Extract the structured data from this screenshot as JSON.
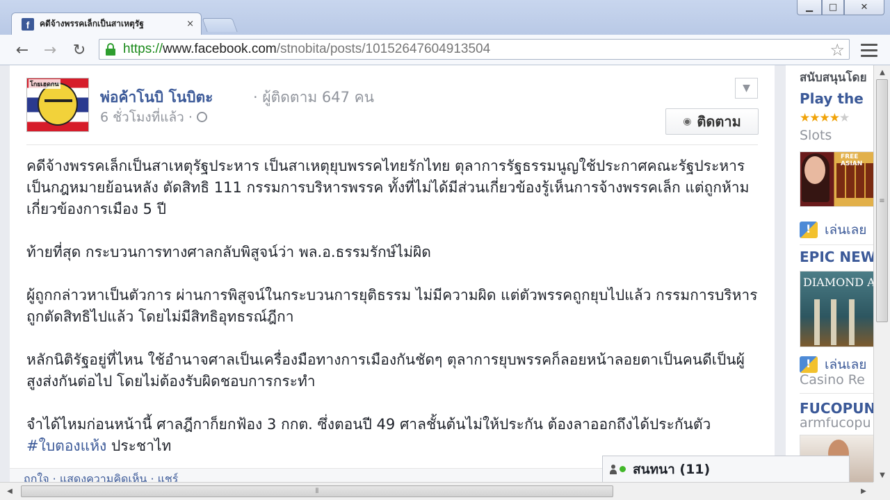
{
  "window": {
    "min_icon": "▁",
    "max_icon": "□",
    "close_icon": "✕"
  },
  "tab": {
    "title": "คดีจ้างพรรคเล็กเป็นสาเหตุรัฐ",
    "favicon": "f",
    "close": "×"
  },
  "toolbar": {
    "back": "←",
    "forward": "→",
    "reload": "↻",
    "url_scheme": "https://",
    "url_host": "www.facebook.com",
    "url_path": "/stnobita/posts/10152647604913504",
    "bookmark_star": "☆"
  },
  "post": {
    "avatar_text": "โกยเฮดกน",
    "author": "พ่อค้าโนบิ โนบิตะ",
    "followers": "· ผู้ติดตาม 647 คน",
    "time": "6 ชั่วโมงที่แล้ว ·",
    "menu_chevron": "▼",
    "follow_label": "ติดตาม",
    "paragraphs": [
      "คดีจ้างพรรคเล็กเป็นสาเหตุรัฐประหาร เป็นสาเหตุยุบพรรคไทยรักไทย ตุลาการรัฐธรรมนูญใช้ประกาศคณะรัฐประหารเป็นกฎหมายย้อนหลัง ตัดสิทธิ 111 กรรมการบริหารพรรค ทั้งที่ไม่ได้มีส่วนเกี่ยวข้องรู้เห็นการจ้างพรรคเล็ก แต่ถูกห้ามเกี่ยวข้องการเมือง 5 ปี",
      "ท้ายที่สุด กระบวนการทางศาลกลับพิสูจน์ว่า พล.อ.ธรรมรักษ์ไม่ผิด",
      "ผู้ถูกกล่าวหาเป็นตัวการ ผ่านการพิสูจน์ในกระบวนการยุติธรรม ไม่มีความผิด แต่ตัวพรรคถูกยุบไปแล้ว กรรมการบริหารถูกตัดสิทธิไปแล้ว โดยไม่มีสิทธิอุทธรณ์ฎีกา",
      "หลักนิติรัฐอยู่ที่ไหน ใช้อำนาจศาลเป็นเครื่องมือทางการเมืองกันชัดๆ ตุลาการยุบพรรคก็ลอยหน้าลอยตาเป็นคนดีเป็นผู้สูงส่งกันต่อไป โดยไม่ต้องรับผิดชอบการกระทำ"
    ],
    "last_paragraph_text": "จำได้ไหมก่อนหน้านี้ ศาลฎีกาก็ยกฟ้อง 3 กกต. ซึ่งตอนปี 49 ศาลชั้นต้นไม่ให้ประกัน ต้องลาออกถึงได้ประกันตัว",
    "hashtag": "#ใบตองแห้ง",
    "last_paragraph_tail": "ประชาไท",
    "actions": "ถูกใจ · แสดงความคิดเห็น · แชร์"
  },
  "sidebar": {
    "header": "สนับสนุนโดย",
    "ad1_title": "Play the",
    "ad1_rating": 3.5,
    "ad1_stars": "★★★★",
    "ad1_stars_dim": "★",
    "ad1_category": "Slots",
    "ad1_image_tag": "FREE ASIAN",
    "play_link_1": "เล่นเลย",
    "ad2_title": "EPIC NEW",
    "ad2_image_title": "DIAMOND ATHENS",
    "play_link_2": "เล่นเลย",
    "ad2_subtitle": "Casino Re",
    "ad3_title": "FUCOPUN",
    "ad3_subtitle": "armfucopu"
  },
  "chat": {
    "label": "สนทนา (11)"
  },
  "scrollbars": {
    "up": "▲",
    "down": "▼",
    "left": "◀",
    "right": "▶",
    "grip": "≡",
    "hgrip": "⦀"
  }
}
